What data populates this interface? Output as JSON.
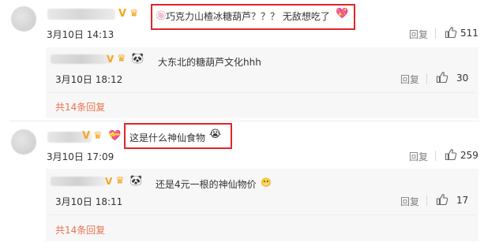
{
  "comments": [
    {
      "text": "巧克力山楂冰糖葫芦？？？ 无敌想吃了",
      "time": "3月10日 14:13",
      "reply_label": "回复",
      "likes": "511",
      "reply": {
        "text": "大东北的糖葫芦文化hhh",
        "time": "3月10日 18:12",
        "reply_label": "回复",
        "likes": "30"
      },
      "total_replies": "共14条回复"
    },
    {
      "text": "这是什么神仙食物",
      "time": "3月10日 17:09",
      "reply_label": "回复",
      "likes": "259",
      "reply": {
        "text": "还是4元一根的神仙物价",
        "time": "3月10日 18:11",
        "reply_label": "回复",
        "likes": "17"
      },
      "total_replies": "共14条回复"
    }
  ],
  "icons": {
    "like": "thumb-up-icon",
    "verified": "v-badge-icon",
    "crown": "crown-badge-icon",
    "panda": "panda-emoji-icon",
    "heart": "heart-badge-icon"
  },
  "colors": {
    "highlight_border": "#e0262a",
    "link": "#eb7350",
    "muted": "#808080"
  }
}
